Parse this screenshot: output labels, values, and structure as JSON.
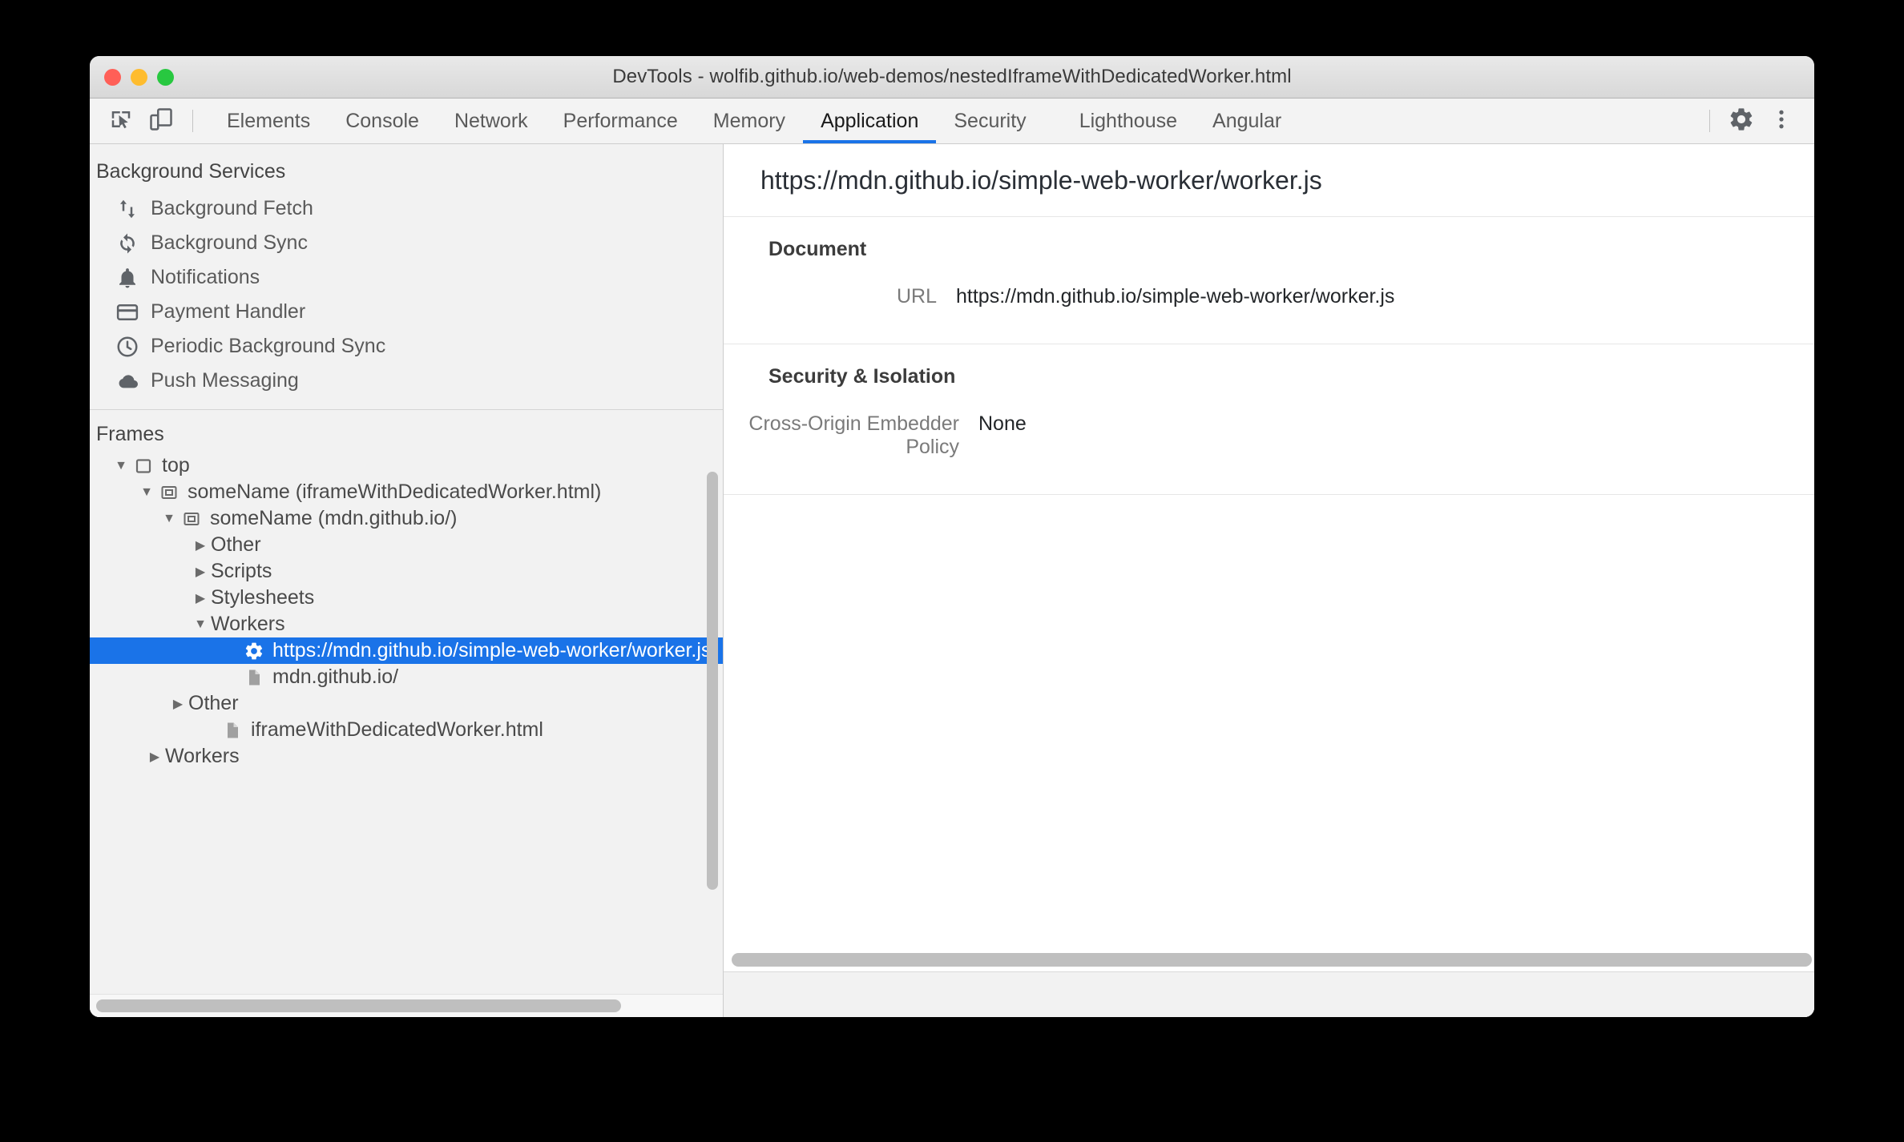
{
  "window": {
    "title": "DevTools - wolfib.github.io/web-demos/nestedIframeWithDedicatedWorker.html",
    "traffic_lights": [
      "close",
      "minimize",
      "zoom"
    ],
    "colors": {
      "accent": "#1a73e8",
      "close": "#ff5f57",
      "minimize": "#febc2e",
      "zoom": "#28c840",
      "selection_bg": "#1a73e8",
      "sidebar_bg": "#f2f2f2",
      "panel_bg": "#ffffff"
    }
  },
  "toolbar": {
    "left_icons": [
      {
        "name": "inspect-element-icon",
        "label": "Inspect element"
      },
      {
        "name": "device-toolbar-icon",
        "label": "Toggle device toolbar"
      }
    ],
    "tabs": [
      {
        "label": "Elements",
        "active": false
      },
      {
        "label": "Console",
        "active": false
      },
      {
        "label": "Network",
        "active": false
      },
      {
        "label": "Performance",
        "active": false
      },
      {
        "label": "Memory",
        "active": false
      },
      {
        "label": "Application",
        "active": true
      },
      {
        "label": "Security",
        "active": false
      },
      {
        "label": "Lighthouse",
        "active": false
      },
      {
        "label": "Angular",
        "active": false
      }
    ],
    "right_icons": [
      {
        "name": "gear-icon",
        "label": "Settings"
      },
      {
        "name": "kebab-menu-icon",
        "label": "Customize and control DevTools"
      }
    ]
  },
  "sidebar": {
    "background_services": {
      "title": "Background Services",
      "items": [
        {
          "label": "Background Fetch",
          "icon": "background-fetch-icon"
        },
        {
          "label": "Background Sync",
          "icon": "background-sync-icon"
        },
        {
          "label": "Notifications",
          "icon": "bell-icon"
        },
        {
          "label": "Payment Handler",
          "icon": "credit-card-icon"
        },
        {
          "label": "Periodic Background Sync",
          "icon": "clock-icon"
        },
        {
          "label": "Push Messaging",
          "icon": "cloud-icon"
        }
      ]
    },
    "frames": {
      "title": "Frames",
      "tree": [
        {
          "label": "top",
          "indent": 0,
          "arrow": "down",
          "icon": "frame-icon",
          "selected": false
        },
        {
          "label": "someName (iframeWithDedicatedWorker.html)",
          "indent": 1,
          "arrow": "down",
          "icon": "iframe-icon",
          "selected": false
        },
        {
          "label": "someName (mdn.github.io/)",
          "indent": 2,
          "arrow": "down",
          "icon": "iframe-icon",
          "selected": false
        },
        {
          "label": "Other",
          "indent": 3,
          "arrow": "right",
          "icon": "none",
          "selected": false
        },
        {
          "label": "Scripts",
          "indent": 3,
          "arrow": "right",
          "icon": "none",
          "selected": false
        },
        {
          "label": "Stylesheets",
          "indent": 3,
          "arrow": "right",
          "icon": "none",
          "selected": false
        },
        {
          "label": "Workers",
          "indent": 3,
          "arrow": "down",
          "icon": "none",
          "selected": false
        },
        {
          "label": "https://mdn.github.io/simple-web-worker/worker.js",
          "indent": 4,
          "arrow": "none",
          "icon": "gear-icon",
          "selected": true
        },
        {
          "label": "mdn.github.io/",
          "indent": 4,
          "arrow": "none",
          "icon": "document-icon",
          "selected": false
        },
        {
          "label": "Other",
          "indent": 2,
          "arrow": "right",
          "icon": "none",
          "selected": false
        },
        {
          "label": "iframeWithDedicatedWorker.html",
          "indent": 3,
          "arrow": "none",
          "icon": "document-icon",
          "selected": false
        },
        {
          "label": "Workers",
          "indent": 1,
          "arrow": "right",
          "icon": "none",
          "selected": false
        }
      ]
    }
  },
  "main": {
    "header_url": "https://mdn.github.io/simple-web-worker/worker.js",
    "sections": [
      {
        "title": "Document",
        "rows": [
          {
            "key": "URL",
            "value": "https://mdn.github.io/simple-web-worker/worker.js"
          }
        ]
      },
      {
        "title": "Security & Isolation",
        "rows": [
          {
            "key": "Cross-Origin Embedder Policy",
            "value": "None"
          }
        ]
      }
    ]
  }
}
